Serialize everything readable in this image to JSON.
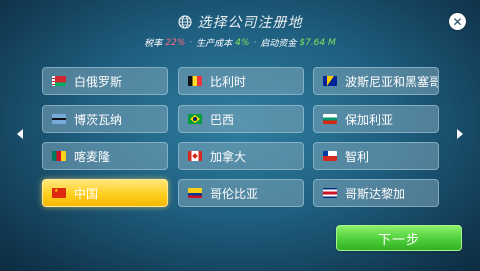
{
  "header": {
    "title": "选择公司注册地",
    "tax_label": "税率",
    "tax_value": "22%",
    "cost_label": "生产成本",
    "cost_value": "4%",
    "fund_label": "启动资金",
    "fund_value": "$7.64 M",
    "separator": "·"
  },
  "icons": {
    "globe": "globe-icon",
    "close": "close-icon",
    "prev": "arrow-left-icon",
    "next": "arrow-right-icon"
  },
  "countries": [
    {
      "name": "白俄罗斯",
      "flag": "belarus",
      "selected": false
    },
    {
      "name": "比利时",
      "flag": "belgium",
      "selected": false
    },
    {
      "name": "波斯尼亚和黑塞哥维",
      "flag": "bosnia",
      "selected": false
    },
    {
      "name": "博茨瓦纳",
      "flag": "botswana",
      "selected": false
    },
    {
      "name": "巴西",
      "flag": "brazil",
      "selected": false
    },
    {
      "name": "保加利亚",
      "flag": "bulgaria",
      "selected": false
    },
    {
      "name": "喀麦隆",
      "flag": "cameroon",
      "selected": false
    },
    {
      "name": "加拿大",
      "flag": "canada",
      "selected": false
    },
    {
      "name": "智利",
      "flag": "chile",
      "selected": false
    },
    {
      "name": "中国",
      "flag": "china",
      "selected": true
    },
    {
      "name": "哥伦比亚",
      "flag": "colombia",
      "selected": false
    },
    {
      "name": "哥斯达黎加",
      "flag": "costa-rica",
      "selected": false
    }
  ],
  "next_button": {
    "label": "下一步"
  },
  "colors": {
    "selected": "#ffcf1f",
    "next_button": "#4fcf3a",
    "tax_value": "#ff6b7a",
    "cost_value": "#7ee35f"
  }
}
